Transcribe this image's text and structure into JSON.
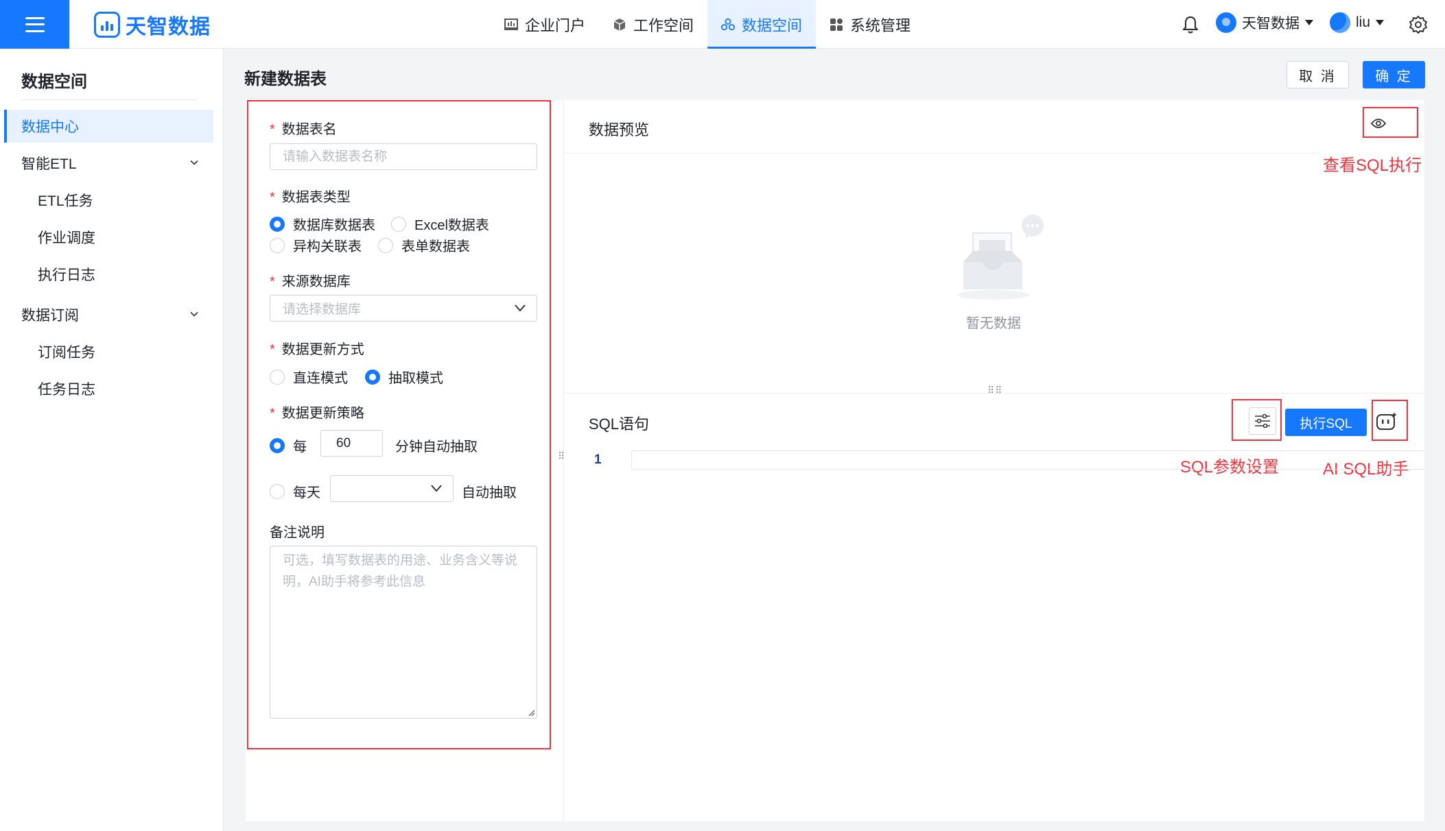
{
  "brand": {
    "name": "天智数据",
    "accent": "#1677ff",
    "annotation_color": "#f2323c"
  },
  "topnav": {
    "items": [
      {
        "label": "企业门户",
        "icon": "portal-icon",
        "active": false
      },
      {
        "label": "工作空间",
        "icon": "cube-icon",
        "active": false
      },
      {
        "label": "数据空间",
        "icon": "data-cluster-icon",
        "active": true
      },
      {
        "label": "系统管理",
        "icon": "grid-icon",
        "active": false
      }
    ]
  },
  "header": {
    "org_name": "天智数据",
    "user_name": "liu"
  },
  "sidebar": {
    "title": "数据空间",
    "items": [
      {
        "label": "数据中心",
        "active": true
      },
      {
        "label": "智能ETL",
        "expandable": true
      },
      {
        "label": "ETL任务",
        "sub": true
      },
      {
        "label": "作业调度",
        "sub": true
      },
      {
        "label": "执行日志",
        "sub": true
      },
      {
        "label": "数据订阅",
        "expandable": true
      },
      {
        "label": "订阅任务",
        "sub": true
      },
      {
        "label": "任务日志",
        "sub": true
      }
    ]
  },
  "page": {
    "title": "新建数据表",
    "cancel_label": "取 消",
    "ok_label": "确 定"
  },
  "form": {
    "required_mark": "*",
    "name": {
      "label": "数据表名",
      "placeholder": "请输入数据表名称"
    },
    "type": {
      "label": "数据表类型",
      "options": [
        "数据库数据表",
        "Excel数据表",
        "异构关联表",
        "表单数据表"
      ],
      "selected": "数据库数据表"
    },
    "source": {
      "label": "来源数据库",
      "placeholder": "请选择数据库"
    },
    "update_mode": {
      "label": "数据更新方式",
      "options": [
        "直连模式",
        "抽取模式"
      ],
      "selected": "抽取模式"
    },
    "strategy": {
      "label": "数据更新策略",
      "every_label": "每",
      "every_value": "60",
      "every_suffix": "分钟自动抽取",
      "daily_label": "每天",
      "daily_suffix": "自动抽取",
      "selected": "每"
    },
    "remark": {
      "label": "备注说明",
      "placeholder": "可选，填写数据表的用途、业务含义等说明，AI助手将参考此信息"
    }
  },
  "preview": {
    "title": "数据预览",
    "empty_text": "暂无数据"
  },
  "sql": {
    "title": "SQL语句",
    "execute_label": "执行SQL",
    "line_number": "1"
  },
  "annotations": {
    "view_sql": "查看SQL执行",
    "sql_params": "SQL参数设置",
    "ai_helper": "AI SQL助手"
  }
}
